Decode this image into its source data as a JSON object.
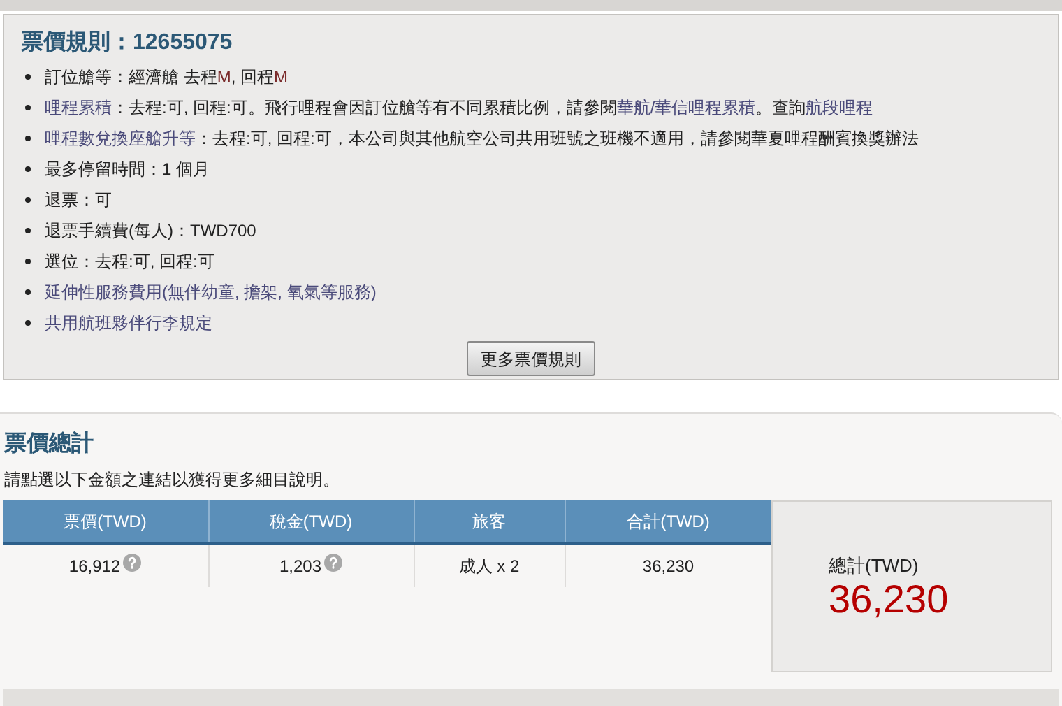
{
  "fare_rules": {
    "title": "票價規則：12655075",
    "items": [
      [
        {
          "kind": "text",
          "text": "訂位艙等：經濟艙 去程 "
        },
        {
          "kind": "code",
          "text": "M"
        },
        {
          "kind": "text",
          "text": ", 回程 "
        },
        {
          "kind": "code",
          "text": "M"
        }
      ],
      [
        {
          "kind": "link",
          "text": "哩程累積"
        },
        {
          "kind": "text",
          "text": "：去程:可, 回程:可。飛行哩程會因訂位艙等有不同累積比例，請參閱"
        },
        {
          "kind": "link",
          "text": "華航/華信哩程累積"
        },
        {
          "kind": "text",
          "text": "。查詢"
        },
        {
          "kind": "link",
          "text": "航段哩程"
        }
      ],
      [
        {
          "kind": "link",
          "text": "哩程數兌換座艙升等"
        },
        {
          "kind": "text",
          "text": "：去程:可, 回程:可，本公司與其他航空公司共用班號之班機不適用，請參閱華夏哩程酬賓換獎辦法"
        }
      ],
      [
        {
          "kind": "text",
          "text": "最多停留時間：1 個月"
        }
      ],
      [
        {
          "kind": "text",
          "text": "退票：可"
        }
      ],
      [
        {
          "kind": "text",
          "text": "退票手續費(每人)：TWD700"
        }
      ],
      [
        {
          "kind": "text",
          "text": "選位：去程:可, 回程:可"
        }
      ],
      [
        {
          "kind": "link",
          "text": "延伸性服務費用(無伴幼童, 擔架, 氧氣等服務)"
        }
      ],
      [
        {
          "kind": "link",
          "text": "共用航班夥伴行李規定"
        }
      ]
    ],
    "more_button": "更多票價規則"
  },
  "fare_total": {
    "title": "票價總計",
    "hint": "請點選以下金額之連結以獲得更多細目說明。",
    "table": {
      "columns": [
        "票價(TWD)",
        "稅金(TWD)",
        "旅客",
        "合計(TWD)"
      ],
      "rows": [
        [
          {
            "text": "16,912",
            "help": true
          },
          {
            "text": "1,203",
            "help": true
          },
          {
            "text": "成人 x 2",
            "help": false
          },
          {
            "text": "36,230",
            "help": false
          }
        ]
      ]
    },
    "grand_total": {
      "label": "總計(TWD)",
      "value": "36,230"
    }
  }
}
